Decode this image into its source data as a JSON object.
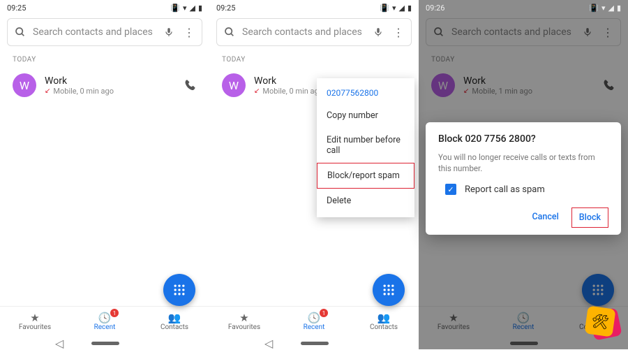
{
  "screens": [
    {
      "time": "09:25",
      "section": "TODAY",
      "entry": {
        "avatar": "W",
        "name": "Work",
        "sub": "Mobile, 0 min ago"
      }
    },
    {
      "time": "09:25",
      "section": "TODAY",
      "entry": {
        "avatar": "W",
        "name": "Work",
        "sub": "Mobile, 0 min ago"
      }
    },
    {
      "time": "09:26",
      "section": "TODAY",
      "entry": {
        "avatar": "W",
        "name": "Work",
        "sub": "Mobile, 1 min ago"
      }
    }
  ],
  "search": {
    "placeholder": "Search contacts and places"
  },
  "tabs": {
    "fav": "Favourites",
    "recent": "Recent",
    "contacts": "Contacts",
    "badge": "1"
  },
  "menu": {
    "number": "02077562800",
    "copy": "Copy number",
    "edit": "Edit number before call",
    "block": "Block/report spam",
    "delete": "Delete"
  },
  "dialog": {
    "title": "Block 020 7756 2800?",
    "body": "You will no longer receive calls or texts from this number.",
    "checkbox": "Report call as spam",
    "cancel": "Cancel",
    "block": "Block"
  }
}
